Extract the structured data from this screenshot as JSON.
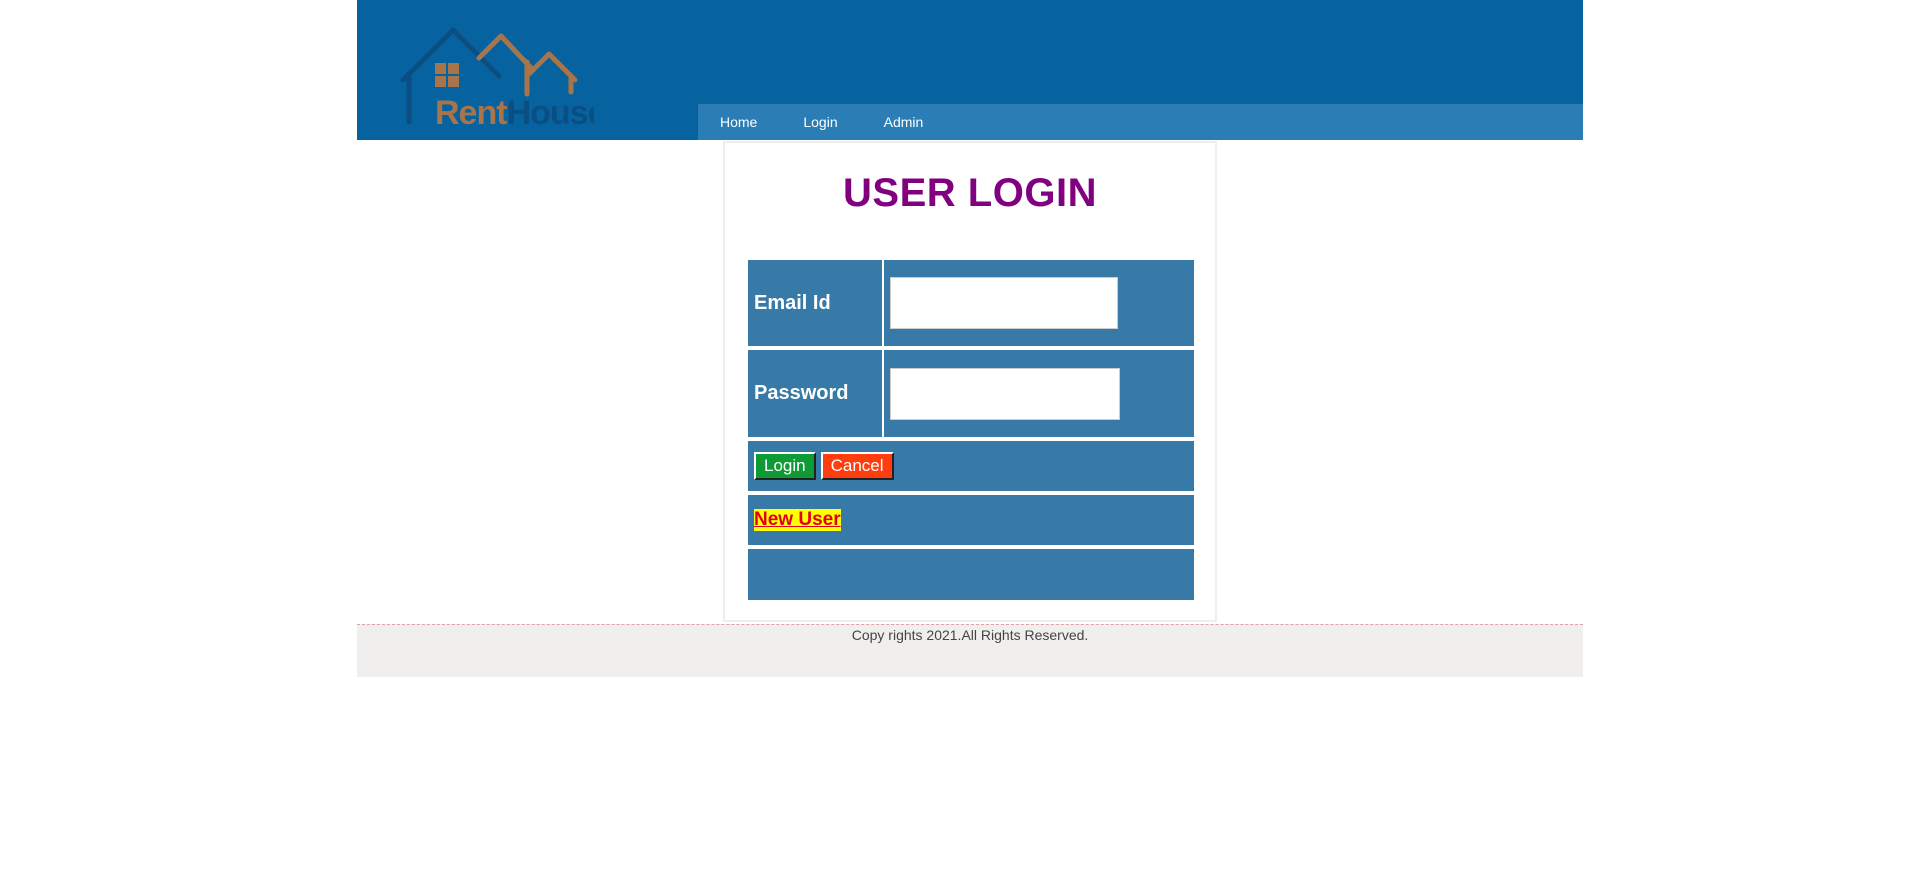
{
  "header": {
    "logo_text_rent": "Rent",
    "logo_text_house": "House",
    "colors": {
      "header_bg": "#0763a0",
      "nav_bg": "#2a7db5",
      "logo_orange": "#a8744a",
      "logo_blue": "#0a4e82"
    }
  },
  "nav": {
    "items": [
      {
        "label": "Home"
      },
      {
        "label": "Login"
      },
      {
        "label": "Admin"
      }
    ]
  },
  "login": {
    "title": "USER LOGIN",
    "email_label": "Email Id",
    "email_value": "",
    "password_label": "Password",
    "password_value": "",
    "login_button": "Login",
    "cancel_button": "Cancel",
    "new_user_link": "New User",
    "colors": {
      "title": "#800080",
      "row_bg": "#377aa7",
      "login_btn": "#0e9a35",
      "cancel_btn": "#ff3d0f",
      "new_user_bg": "#ffff00",
      "new_user_text": "#e0001a"
    }
  },
  "footer": {
    "text": "Copy rights 2021.All Rights Reserved."
  }
}
